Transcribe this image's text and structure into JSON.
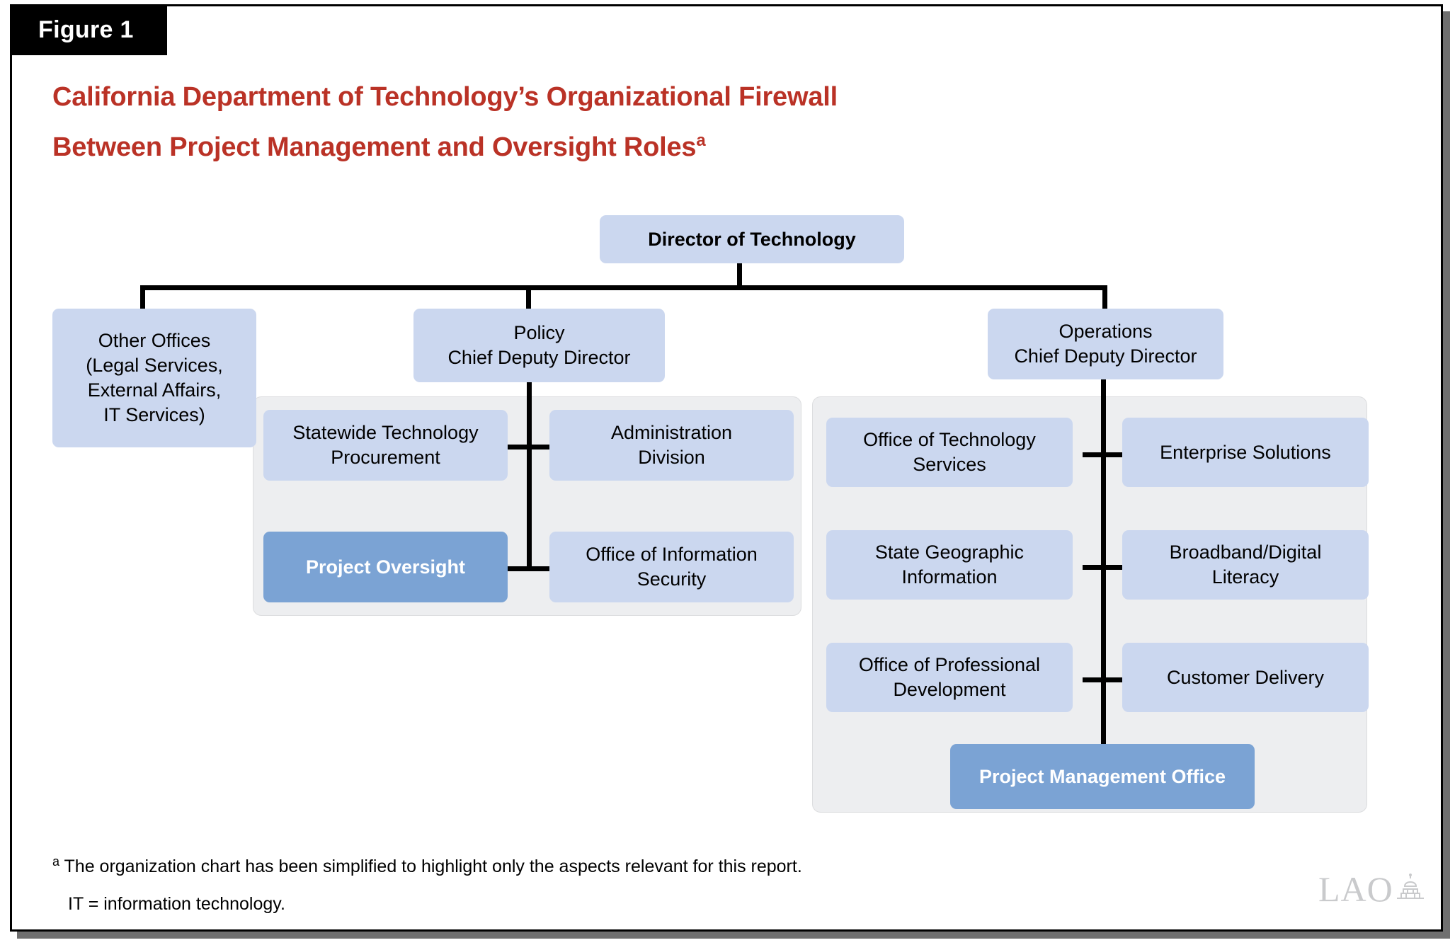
{
  "figure": {
    "tab_label": "Figure 1",
    "title_line1": "California Department of Technology’s Organizational Firewall",
    "title_line2": "Between Project Management and Oversight Roles",
    "title_superscript": "a"
  },
  "colors": {
    "title_red": "#BA3226",
    "node_fill": "#CBD7EF",
    "node_highlight_fill": "#7BA3D4",
    "group_fill": "#EDEEF0",
    "line": "#000000",
    "tab_background": "#000000",
    "logo_gray": "#C9CACC"
  },
  "chart_data": {
    "type": "diagram",
    "title": "California Department of Technology’s Organizational Firewall Between Project Management and Oversight Roles",
    "nodes": [
      {
        "id": "director",
        "label": "Director of Technology",
        "level": 0,
        "style": "bold"
      },
      {
        "id": "other-offices",
        "label": "Other Offices\n(Legal Services,\nExternal Affairs,\nIT Services)",
        "level": 1,
        "style": "normal"
      },
      {
        "id": "policy",
        "label": "Policy\nChief Deputy Director",
        "level": 1,
        "style": "normal"
      },
      {
        "id": "operations",
        "label": "Operations\nChief Deputy Director",
        "level": 1,
        "style": "normal"
      },
      {
        "id": "statewide-technology-procurement",
        "label": "Statewide Technology\nProcurement",
        "level": 2,
        "parent": "policy",
        "style": "normal"
      },
      {
        "id": "administration-division",
        "label": "Administration\nDivision",
        "level": 2,
        "parent": "policy",
        "style": "normal"
      },
      {
        "id": "project-oversight",
        "label": "Project Oversight",
        "level": 2,
        "parent": "policy",
        "style": "highlight"
      },
      {
        "id": "office-of-information-security",
        "label": "Office of Information\nSecurity",
        "level": 2,
        "parent": "policy",
        "style": "normal"
      },
      {
        "id": "office-of-technology-services",
        "label": "Office of Technology\nServices",
        "level": 2,
        "parent": "operations",
        "style": "normal"
      },
      {
        "id": "enterprise-solutions",
        "label": "Enterprise Solutions",
        "level": 2,
        "parent": "operations",
        "style": "normal"
      },
      {
        "id": "state-geographic-information",
        "label": "State Geographic\nInformation",
        "level": 2,
        "parent": "operations",
        "style": "normal"
      },
      {
        "id": "broadband-digital-literacy",
        "label": "Broadband/Digital\nLiteracy",
        "level": 2,
        "parent": "operations",
        "style": "normal"
      },
      {
        "id": "office-of-professional-development",
        "label": "Office of Professional\nDevelopment",
        "level": 2,
        "parent": "operations",
        "style": "normal"
      },
      {
        "id": "customer-delivery",
        "label": "Customer Delivery",
        "level": 2,
        "parent": "operations",
        "style": "normal"
      },
      {
        "id": "project-management-office",
        "label": "Project Management Office",
        "level": 2,
        "parent": "operations",
        "style": "highlight"
      }
    ],
    "edges": [
      {
        "from": "director",
        "to": "other-offices"
      },
      {
        "from": "director",
        "to": "policy"
      },
      {
        "from": "director",
        "to": "operations"
      },
      {
        "from": "policy",
        "to": "statewide-technology-procurement"
      },
      {
        "from": "policy",
        "to": "administration-division"
      },
      {
        "from": "policy",
        "to": "project-oversight"
      },
      {
        "from": "policy",
        "to": "office-of-information-security"
      },
      {
        "from": "operations",
        "to": "office-of-technology-services"
      },
      {
        "from": "operations",
        "to": "enterprise-solutions"
      },
      {
        "from": "operations",
        "to": "state-geographic-information"
      },
      {
        "from": "operations",
        "to": "broadband-digital-literacy"
      },
      {
        "from": "operations",
        "to": "office-of-professional-development"
      },
      {
        "from": "operations",
        "to": "customer-delivery"
      },
      {
        "from": "operations",
        "to": "project-management-office"
      }
    ]
  },
  "nodes": {
    "director": "Director of Technology",
    "other_offices": "Other Offices\n(Legal Services,\nExternal Affairs,\nIT Services)",
    "policy": "Policy\nChief Deputy Director",
    "operations": "Operations\nChief Deputy Director",
    "statewide_technology_procurement": "Statewide Technology\nProcurement",
    "administration_division": "Administration\nDivision",
    "project_oversight": "Project Oversight",
    "office_of_information_security": "Office of Information\nSecurity",
    "office_of_technology_services": "Office of Technology\nServices",
    "enterprise_solutions": "Enterprise Solutions",
    "state_geographic_information": "State Geographic\nInformation",
    "broadband_digital_literacy": "Broadband/Digital\nLiteracy",
    "office_of_professional_development": "Office of Professional\nDevelopment",
    "customer_delivery": "Customer Delivery",
    "project_management_office": "Project Management Office"
  },
  "footnotes": {
    "a_marker": "a",
    "a_text": "The organization chart has been simplified to highlight only the aspects relevant for this report.",
    "abbreviation": "IT = information technology."
  },
  "logo": {
    "text": "LAO",
    "icon": "capitol-dome-icon"
  }
}
